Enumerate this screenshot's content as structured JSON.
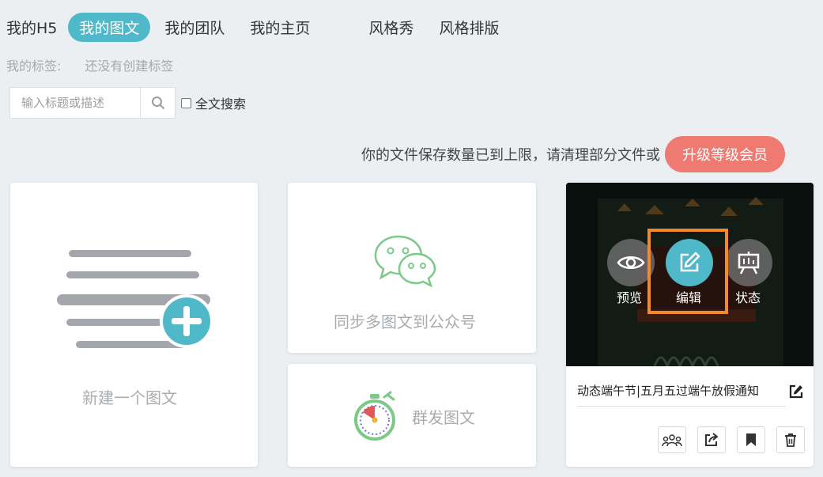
{
  "nav": {
    "items": [
      {
        "label": "我的H5"
      },
      {
        "label": "我的图文",
        "active": true
      },
      {
        "label": "我的团队"
      },
      {
        "label": "我的主页"
      },
      {
        "label": "风格秀"
      },
      {
        "label": "风格排版"
      }
    ]
  },
  "tags": {
    "label": "我的标签:",
    "empty": "还没有创建标签"
  },
  "search": {
    "placeholder": "输入标题或描述",
    "fulltext_label": "全文搜索",
    "fulltext_checked": false
  },
  "notice": {
    "text": "你的文件保存数量已到上限，请清理部分文件或",
    "upgrade_label": "升级等级会员"
  },
  "cards": {
    "new_label": "新建一个图文",
    "sync_label": "同步多图文到公众号",
    "mass_label": "群发图文"
  },
  "item": {
    "title": "动态端午节|五月五过端午放假通知",
    "actions": {
      "preview": "预览",
      "edit": "编辑",
      "status": "状态"
    }
  },
  "colors": {
    "accent": "#4fb9c9",
    "upgrade": "#ef7a72",
    "highlight": "#f08a2c",
    "wechat_green": "#7cc98a"
  },
  "icons": [
    "search-icon",
    "plus-icon",
    "wechat-icon",
    "stopwatch-icon",
    "eye-icon",
    "edit-icon",
    "easel-icon",
    "team-icon",
    "share-icon",
    "bookmark-icon",
    "trash-icon",
    "edit-title-icon"
  ]
}
